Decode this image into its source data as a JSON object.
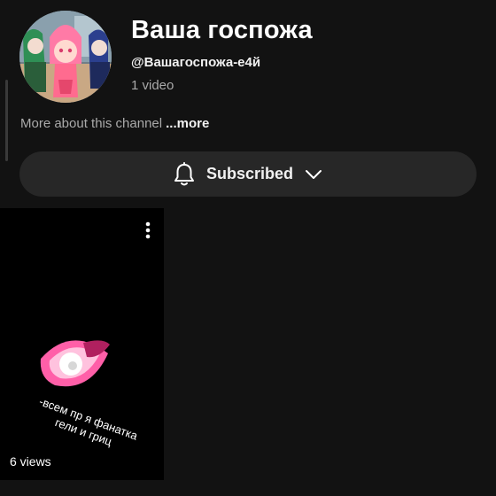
{
  "channel": {
    "name": "Ваша госпожа",
    "handle": "@Вашагоспожа-е4й",
    "video_count": "1 video",
    "about_text": "More about this channel",
    "more_label": "...more"
  },
  "subscribe": {
    "label": "Subscribed",
    "icon": "bell-icon",
    "dropdown_icon": "chevron-down-icon"
  },
  "videos": [
    {
      "overlay_text": "-всем пр я фанатка гели и гриц",
      "views": "6 views"
    }
  ],
  "colors": {
    "background": "#121212",
    "button": "#272727",
    "secondary_text": "#aaaaaa",
    "accent_pink": "#ff5fa8"
  }
}
